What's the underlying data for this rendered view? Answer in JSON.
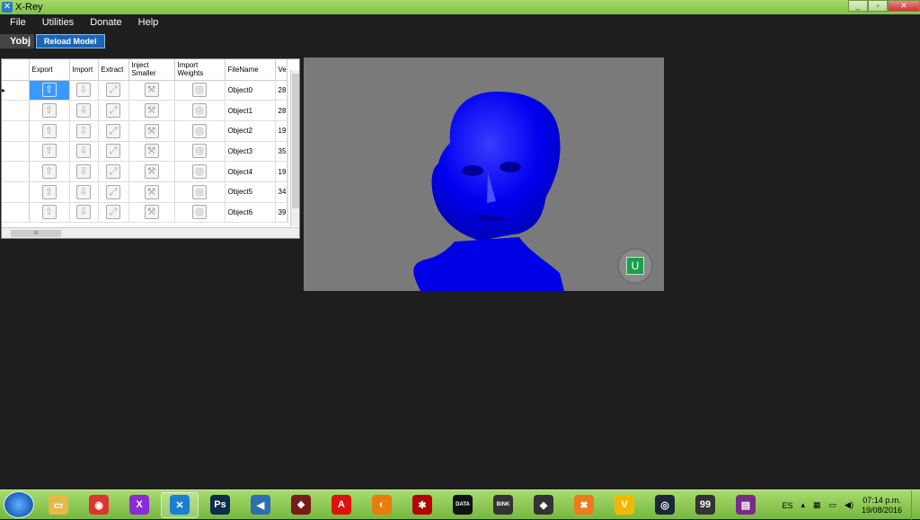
{
  "window": {
    "title": "X-Rey"
  },
  "menu": [
    "File",
    "Utilities",
    "Donate",
    "Help"
  ],
  "toolbar": {
    "yobj_label": "Yobj",
    "reload_label": "Reload Model"
  },
  "grid": {
    "columns": [
      "Export",
      "Import",
      "Extract",
      "Inject Smaller",
      "Import Weights",
      "FileName",
      "Ve"
    ],
    "rows": [
      {
        "filename": "Object0",
        "ve": "28"
      },
      {
        "filename": "Object1",
        "ve": "28"
      },
      {
        "filename": "Object2",
        "ve": "19"
      },
      {
        "filename": "Object3",
        "ve": "35"
      },
      {
        "filename": "Object4",
        "ve": "19"
      },
      {
        "filename": "Object5",
        "ve": "34"
      },
      {
        "filename": "Object6",
        "ve": "39"
      }
    ],
    "current_row_marker": "▸",
    "hscroll_grip": "III"
  },
  "viewport": {
    "background": "#7a7a7a",
    "model_color": "#0000ff",
    "badge_label": "U"
  },
  "taskbar": {
    "items": [
      {
        "icon": "file-explorer-icon",
        "glyph": "▭",
        "color": "#e6b84a"
      },
      {
        "icon": "chrome-icon",
        "glyph": "◉",
        "color": "#d33"
      },
      {
        "icon": "x-app-purple-icon",
        "glyph": "X",
        "color": "#8a2bd6"
      },
      {
        "icon": "x-rey-icon",
        "glyph": "✕",
        "color": "#1a7fd0"
      },
      {
        "icon": "photoshop-icon",
        "glyph": "Ps",
        "color": "#0b2c4a"
      },
      {
        "icon": "audio-app-icon",
        "glyph": "◀",
        "color": "#2a6fb0"
      },
      {
        "icon": "shield-app-icon",
        "glyph": "❖",
        "color": "#7a1a1a"
      },
      {
        "icon": "adobe-app-icon",
        "glyph": "A",
        "color": "#d11"
      },
      {
        "icon": "blender-icon",
        "glyph": "◐",
        "color": "#e87d0d"
      },
      {
        "icon": "gear-app-icon",
        "glyph": "✱",
        "color": "#b30000"
      },
      {
        "icon": "data-edit-icon",
        "glyph": "DATA",
        "color": "#111"
      },
      {
        "icon": "bink-video-icon",
        "glyph": "BINK",
        "color": "#333"
      },
      {
        "icon": "diamond-app-icon",
        "glyph": "◆",
        "color": "#333"
      },
      {
        "icon": "orange-x-app-icon",
        "glyph": "✖",
        "color": "#f07a20"
      },
      {
        "icon": "yellow-app-icon",
        "glyph": "V",
        "color": "#f5b800"
      },
      {
        "icon": "steam-icon",
        "glyph": "◎",
        "color": "#1b2838"
      },
      {
        "icon": "monitor-app-icon",
        "glyph": "99",
        "color": "#333"
      },
      {
        "icon": "winrar-icon",
        "glyph": "▤",
        "color": "#7a2a8a"
      }
    ],
    "language": "ES",
    "time": "07:14 p.m.",
    "date": "19/08/2016"
  }
}
